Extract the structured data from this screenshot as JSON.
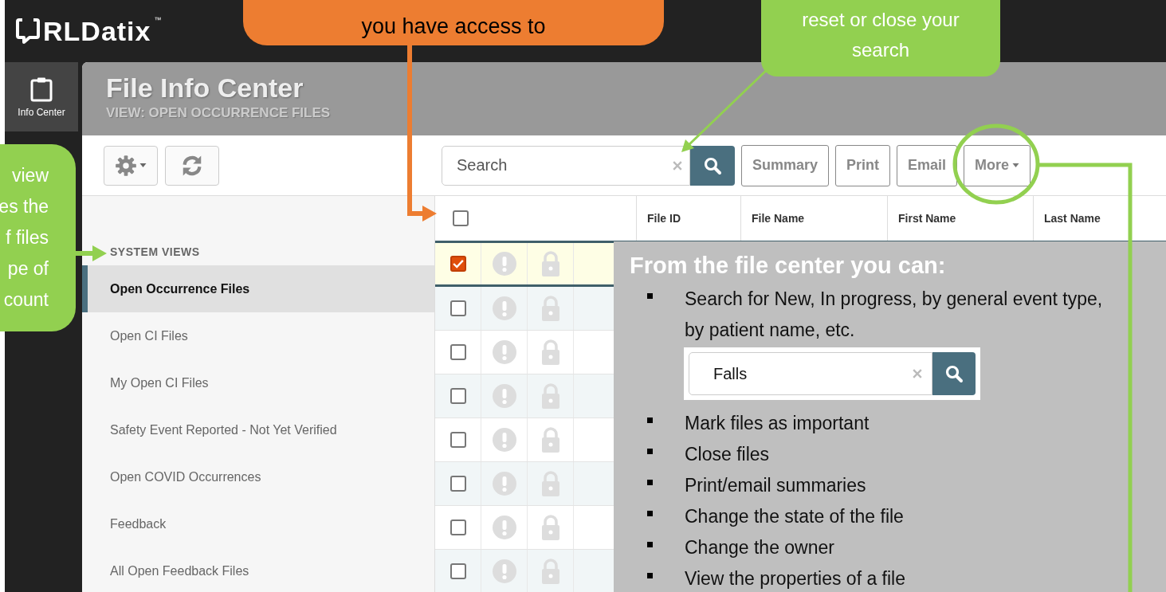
{
  "brand": {
    "logo": "RLDatix",
    "trademark": "™"
  },
  "rail": [
    {
      "label": "Info Center",
      "selected": true
    }
  ],
  "header": {
    "title": "File Info Center",
    "view": "VIEW: OPEN OCCURRENCE FILES"
  },
  "toolbar": {
    "search": {
      "placeholder": "Search"
    },
    "buttons": [
      {
        "label": "Summary",
        "kind": "plain"
      },
      {
        "label": "Print",
        "kind": "plain"
      },
      {
        "label": "Email",
        "kind": "plain"
      },
      {
        "label": "More",
        "kind": "dropdown"
      }
    ]
  },
  "sidebar": {
    "heading": "SYSTEM VIEWS",
    "items": [
      {
        "label": "Open Occurrence Files",
        "selected": true
      },
      {
        "label": "Open CI Files",
        "selected": false
      },
      {
        "label": "My Open CI Files",
        "selected": false
      },
      {
        "label": "Safety Event Reported - Not Yet Verified",
        "selected": false
      },
      {
        "label": "Open COVID Occurrences",
        "selected": false
      },
      {
        "label": "Feedback",
        "selected": false
      },
      {
        "label": "All Open Feedback Files",
        "selected": false
      }
    ]
  },
  "grid": {
    "all_checked": false,
    "columns": [
      "File ID",
      "File Name",
      "First Name",
      "Last Name"
    ],
    "rows": [
      {
        "selected": true,
        "checked": true
      },
      {
        "selected": false,
        "checked": false
      },
      {
        "selected": false,
        "checked": false
      },
      {
        "selected": false,
        "checked": false
      },
      {
        "selected": false,
        "checked": false
      },
      {
        "selected": false,
        "checked": false
      },
      {
        "selected": false,
        "checked": false
      },
      {
        "selected": false,
        "checked": false
      }
    ]
  },
  "info_box": {
    "title": "From the file center you can:",
    "items": [
      {
        "kind": "text",
        "text": "Search for New, In progress, by general event type, by patient name, etc."
      },
      {
        "kind": "search",
        "value": "Falls"
      },
      {
        "kind": "text",
        "text": "Mark files as important"
      },
      {
        "kind": "text",
        "text": "Close files"
      },
      {
        "kind": "text",
        "text": "Print/email summaries"
      },
      {
        "kind": "text",
        "text": "Change the state of the file"
      },
      {
        "kind": "text",
        "text": "Change the owner"
      },
      {
        "kind": "text",
        "text": "View the properties of a file"
      }
    ]
  },
  "callouts": [
    {
      "kind": "top",
      "color": "#ed7d31",
      "lines": [
        "you have access to"
      ]
    },
    {
      "kind": "search",
      "color": "#92d050",
      "lines": [
        "reset or close your",
        "search"
      ]
    },
    {
      "kind": "left",
      "color": "#92d050",
      "lines": [
        "view",
        "es the",
        "f files",
        "pe of",
        "count"
      ]
    },
    {
      "kind": "more",
      "color": "#92d050"
    }
  ]
}
